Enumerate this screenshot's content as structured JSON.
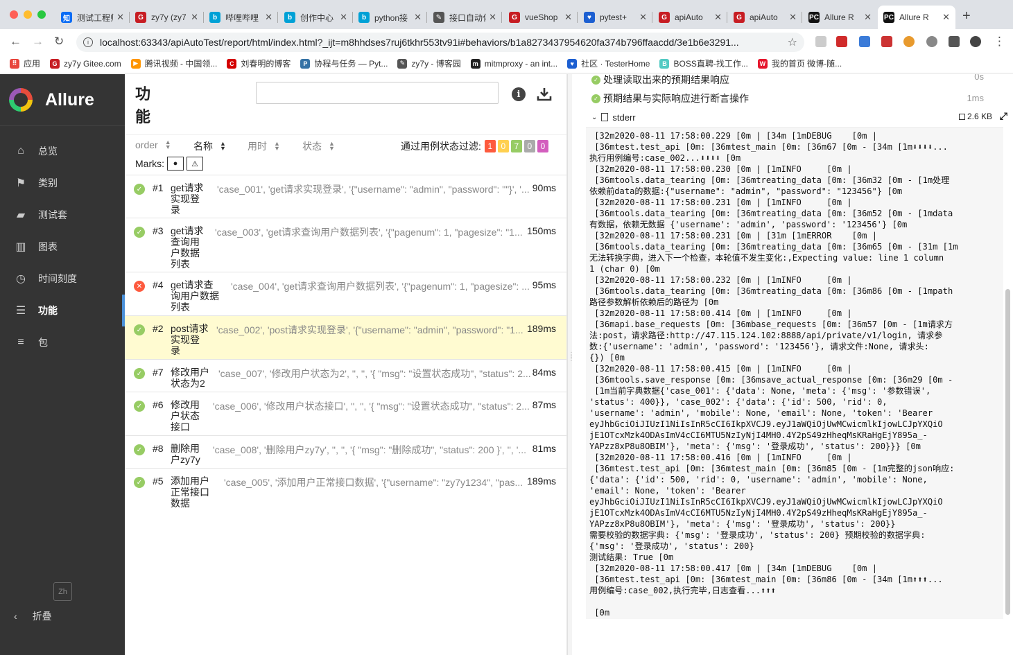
{
  "browser": {
    "tabs": [
      {
        "title": "测试工程师",
        "icon_text": "知",
        "color": "#0a6cf5"
      },
      {
        "title": "zy7y (zy7",
        "icon_text": "G",
        "color": "#c71d23"
      },
      {
        "title": "哔哩哔哩",
        "icon_text": "b",
        "color": "#00a1d6"
      },
      {
        "title": "创作中心",
        "icon_text": "b",
        "color": "#00a1d6"
      },
      {
        "title": "python接",
        "icon_text": "b",
        "color": "#00a1d6"
      },
      {
        "title": "接口自动化",
        "icon_text": "✎",
        "color": "#555555"
      },
      {
        "title": "vueShop",
        "icon_text": "G",
        "color": "#c71d23"
      },
      {
        "title": "pytest+",
        "icon_text": "♥",
        "color": "#1c5fd1"
      },
      {
        "title": "apiAuto",
        "icon_text": "G",
        "color": "#c71d23"
      },
      {
        "title": "apiAuto",
        "icon_text": "G",
        "color": "#c71d23"
      },
      {
        "title": "Allure R",
        "icon_text": "PC",
        "color": "#111111"
      },
      {
        "title": "Allure R",
        "icon_text": "PC",
        "color": "#111111"
      }
    ],
    "new_tab": "+",
    "url": "localhost:63343/apiAutoTest/report/html/index.html?_ijt=m8hhdses7ruj6tkhr553tv91i#behaviors/b1a8273437954620fa374b796ffaacdd/3e1b6e3291...",
    "bookmarks": [
      {
        "label": "应用",
        "color": "#e8453c",
        "icon_text": "⠿"
      },
      {
        "label": "zy7y Gitee.com",
        "color": "#c71d23",
        "icon_text": "G"
      },
      {
        "label": "腾讯视频 - 中国领...",
        "color": "#ff9600",
        "icon_text": "▶"
      },
      {
        "label": "刘春明的博客",
        "color": "#d40000",
        "icon_text": "C"
      },
      {
        "label": "协程与任务 — Pyt...",
        "color": "#3572a5",
        "icon_text": "P"
      },
      {
        "label": "zy7y - 博客园",
        "color": "#555555",
        "icon_text": "✎"
      },
      {
        "label": "mitmproxy - an int...",
        "color": "#222222",
        "icon_text": "m"
      },
      {
        "label": "社区 · TesterHome",
        "color": "#1c5fd1",
        "icon_text": "♥"
      },
      {
        "label": "BOSS直聘-找工作...",
        "color": "#53cac3",
        "icon_text": "B"
      },
      {
        "label": "我的首页 微博-随...",
        "color": "#e6162d",
        "icon_text": "W"
      }
    ]
  },
  "sidebar": {
    "logo": "Allure",
    "items": [
      {
        "label": "总览",
        "icon": "home-icon"
      },
      {
        "label": "类别",
        "icon": "flag-icon"
      },
      {
        "label": "测试套",
        "icon": "briefcase-icon"
      },
      {
        "label": "图表",
        "icon": "bar-chart-icon"
      },
      {
        "label": "时间刻度",
        "icon": "clock-icon"
      },
      {
        "label": "功能",
        "icon": "list-icon"
      },
      {
        "label": "包",
        "icon": "align-icon"
      }
    ],
    "lang": "Zh",
    "collapse": "折叠"
  },
  "middle": {
    "title": "功能",
    "sort": {
      "order": "order",
      "name": "名称",
      "duration": "用时",
      "status": "状态"
    },
    "filter_label": "通过用例状态过滤:",
    "status_counts": [
      {
        "count": "1",
        "color": "#fd5a3e"
      },
      {
        "count": "0",
        "color": "#ffd050"
      },
      {
        "count": "7",
        "color": "#97cc64"
      },
      {
        "count": "0",
        "color": "#aaaaaa"
      },
      {
        "count": "0",
        "color": "#d35ebe"
      }
    ],
    "marks_label": "Marks:",
    "rows": [
      {
        "num": "#1",
        "name_lines": [
          "get请求",
          "实现登",
          "录"
        ],
        "params": "'case_001', 'get请求实现登录', '{\"username\": \"admin\", \"password\": \"\"}', '...",
        "duration": "90ms",
        "status": "passed"
      },
      {
        "num": "#3",
        "name_lines": [
          "get请求",
          "查询用",
          "户数据",
          "列表"
        ],
        "params": "'case_003', 'get请求查询用户数据列表', '{\"pagenum\": 1, \"pagesize\": \"1...",
        "duration": "150ms",
        "status": "passed"
      },
      {
        "num": "#4",
        "name_lines": [
          "get请求查",
          "询用户数据",
          "列表"
        ],
        "params": "'case_004', 'get请求查询用户数据列表', '{\"pagenum\": 1, \"pagesize\": ...",
        "duration": "95ms",
        "status": "failed"
      },
      {
        "num": "#2",
        "name_lines": [
          "post请求",
          "实现登",
          "录"
        ],
        "params": "'case_002', 'post请求实现登录', '{\"username\": \"admin\", \"password\": \"1...",
        "duration": "189ms",
        "status": "passed"
      },
      {
        "num": "#7",
        "name_lines": [
          "修改用户",
          "状态为2"
        ],
        "params": "'case_007', '修改用户状态为2', '', '', '{ \"msg\": \"设置状态成功\", \"status\": 2...",
        "duration": "84ms",
        "status": "passed"
      },
      {
        "num": "#6",
        "name_lines": [
          "修改用",
          "户状态",
          "接口"
        ],
        "params": "'case_006', '修改用户状态接口', '', '', '{ \"msg\": \"设置状态成功\", \"status\": 2...",
        "duration": "87ms",
        "status": "passed"
      },
      {
        "num": "#8",
        "name_lines": [
          "删除用",
          "户zy7y"
        ],
        "params": "'case_008', '删除用户zy7y', '', '', '{ \"msg\": \"删除成功\", \"status\": 200 }', '', '...",
        "duration": "81ms",
        "status": "passed"
      },
      {
        "num": "#5",
        "name_lines": [
          "添加用户",
          "正常接口",
          "数据"
        ],
        "params": "'case_005', '添加用户正常接口数据', '{\"username\": \"zy7y1234\", \"pas...",
        "duration": "189ms",
        "status": "passed"
      }
    ]
  },
  "right": {
    "steps": [
      {
        "label": "处理读取出来的预期结果响应",
        "duration": "0s"
      },
      {
        "label": "预期结果与实际响应进行断言操作",
        "duration": "1ms"
      }
    ],
    "attachment": {
      "name": "stderr",
      "size": "2.6 KB"
    },
    "log": [
      " [32m2020-08-11 17:58:00.229 [0m | [34m [1mDEBUG    [0m |",
      " [36mtest.test_api [0m: [36mtest_main [0m: [36m67 [0m - [34m [1m⬇⬇⬇⬇...",
      "执行用例编号:case_002...⬇⬇⬇⬇ [0m",
      " [32m2020-08-11 17:58:00.230 [0m | [1mINFO     [0m |",
      " [36mtools.data_tearing [0m: [36mtreating_data [0m: [36m32 [0m - [1m处理",
      "依赖前data的数据:{\"username\": \"admin\", \"password\": \"123456\"} [0m",
      " [32m2020-08-11 17:58:00.231 [0m | [1mINFO     [0m |",
      " [36mtools.data_tearing [0m: [36mtreating_data [0m: [36m52 [0m - [1mdata",
      "有数据，依赖无数据 {'username': 'admin', 'password': '123456'} [0m",
      " [32m2020-08-11 17:58:00.231 [0m | [31m [1mERROR    [0m |",
      " [36mtools.data_tearing [0m: [36mtreating_data [0m: [36m65 [0m - [31m [1m",
      "无法转换字典，进入下一个检查，本轮值不发生变化:,Expecting value: line 1 column",
      "1 (char 0) [0m",
      " [32m2020-08-11 17:58:00.232 [0m | [1mINFO     [0m |",
      " [36mtools.data_tearing [0m: [36mtreating_data [0m: [36m86 [0m - [1mpath",
      "路径参数解析依赖后的路径为 [0m",
      " [32m2020-08-11 17:58:00.414 [0m | [1mINFO     [0m |",
      " [36mapi.base_requests [0m: [36mbase_requests [0m: [36m57 [0m - [1m请求方",
      "法:post，请求路径:http://47.115.124.102:8888/api/private/v1/login, 请求参",
      "数:{'username': 'admin', 'password': '123456'}, 请求文件:None, 请求头:",
      "{}) [0m",
      " [32m2020-08-11 17:58:00.415 [0m | [1mINFO     [0m |",
      " [36mtools.save_response [0m: [36msave_actual_response [0m: [36m29 [0m -",
      " [1m当前字典数据{'case_001': {'data': None, 'meta': {'msg': '参数错误',",
      "'status': 400}}, 'case_002': {'data': {'id': 500, 'rid': 0,",
      "'username': 'admin', 'mobile': None, 'email': None, 'token': 'Bearer",
      "eyJhbGciOiJIUzI1NiIsInR5cCI6IkpXVCJ9.eyJ1aWQiOjUwMCwicmlkIjowLCJpYXQiO",
      "jE1OTcxMzk4ODAsImV4cCI6MTU5NzIyNjI4MH0.4Y2pS49zHheqMsKRaHgEjY895a_-",
      "YAPzz8xP8u8OBIM'}, 'meta': {'msg': '登录成功', 'status': 200}}} [0m",
      " [32m2020-08-11 17:58:00.416 [0m | [1mINFO     [0m |",
      " [36mtest.test_api [0m: [36mtest_main [0m: [36m85 [0m - [1m完整的json响应:",
      "{'data': {'id': 500, 'rid': 0, 'username': 'admin', 'mobile': None,",
      "'email': None, 'token': 'Bearer",
      "eyJhbGciOiJIUzI1NiIsInR5cCI6IkpXVCJ9.eyJ1aWQiOjUwMCwicmlkIjowLCJpYXQiO",
      "jE1OTcxMzk4ODAsImV4cCI6MTU5NzIyNjI4MH0.4Y2pS49zHheqMsKRaHgEjY895a_-",
      "YAPzz8xP8u8OBIM'}, 'meta': {'msg': '登录成功', 'status': 200}}",
      "需要校验的数据字典: {'msg': '登录成功', 'status': 200} 预期校验的数据字典:",
      "{'msg': '登录成功', 'status': 200}",
      "测试结果: True [0m",
      " [32m2020-08-11 17:58:00.417 [0m | [34m [1mDEBUG    [0m |",
      " [36mtest.test_api [0m: [36mtest_main [0m: [36m86 [0m - [34m [1m⬆⬆⬆...",
      "用例编号:case_002,执行完毕,日志查看...⬆⬆⬆",
      "",
      " [0m"
    ]
  }
}
